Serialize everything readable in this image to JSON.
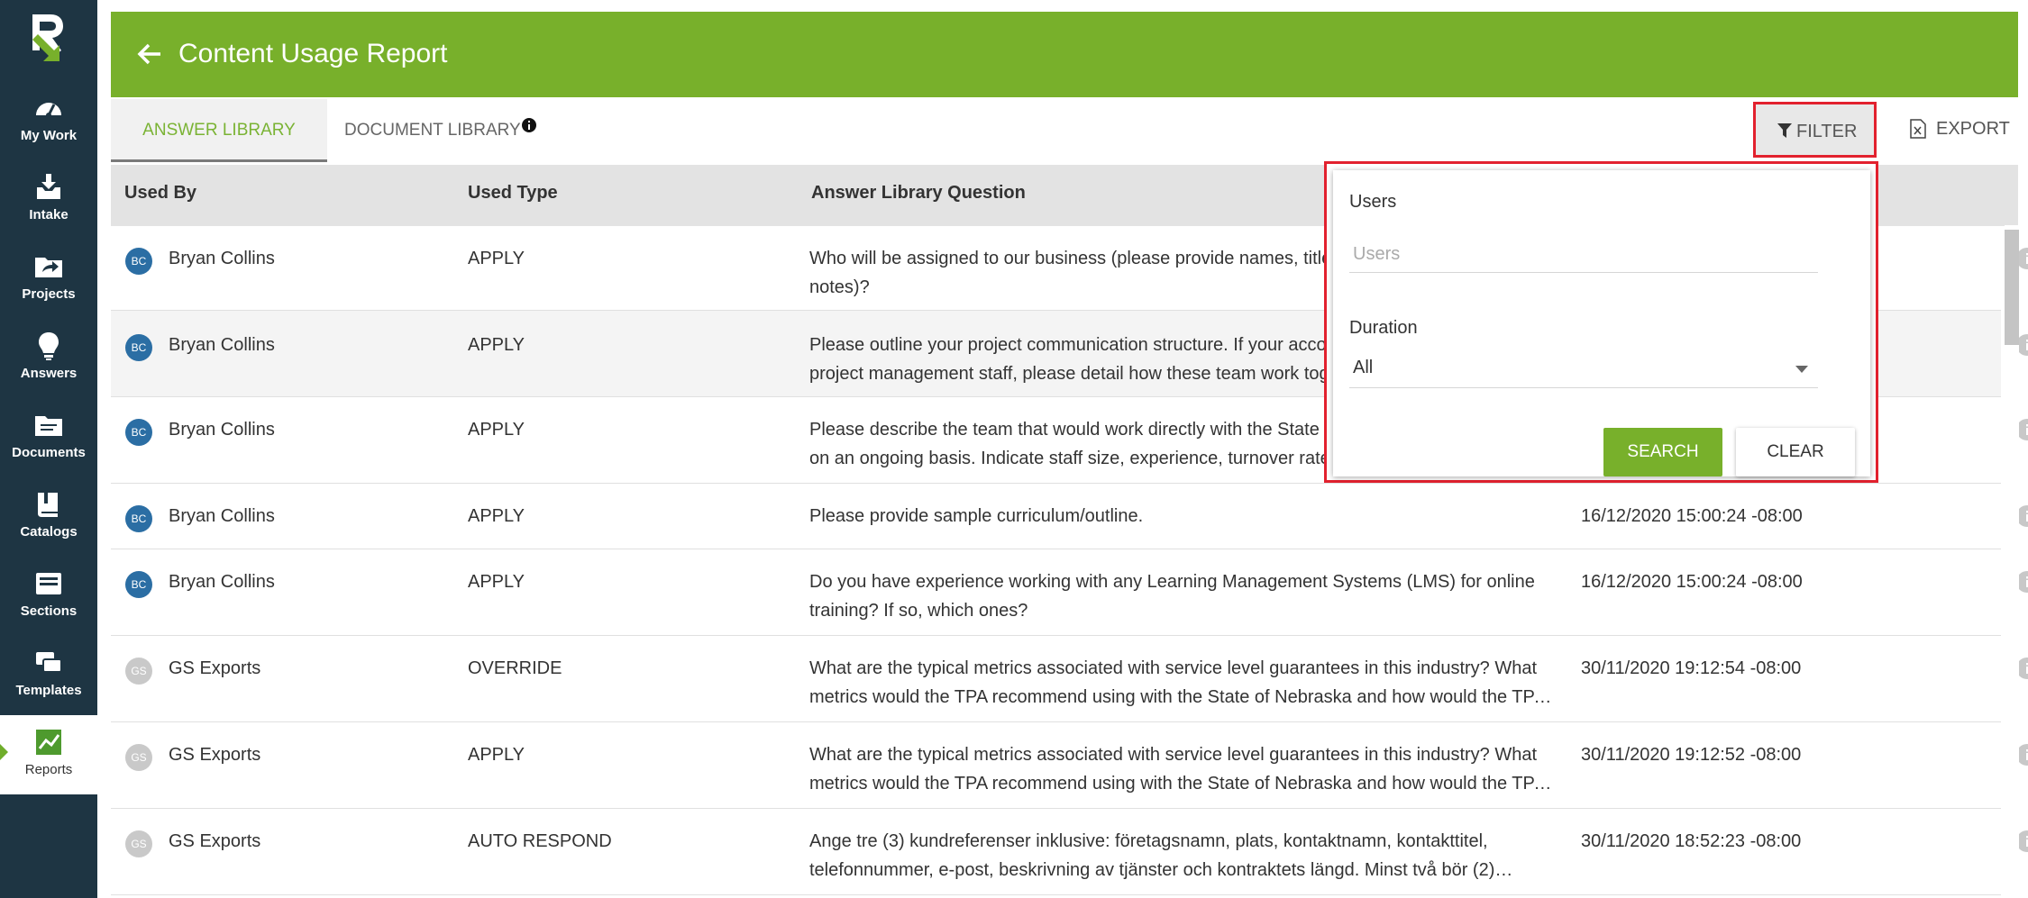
{
  "app": {
    "title": "Content Usage Report"
  },
  "colors": {
    "sidebar": "#1e3543",
    "brand_green": "#78b02b",
    "highlight_red": "#e2212e",
    "avatar_blue": "#2b6ea4",
    "avatar_grey": "#c9c9c9"
  },
  "sidebar": {
    "items": [
      {
        "label": "My Work",
        "icon": "speedometer-icon"
      },
      {
        "label": "Intake",
        "icon": "download-tray-icon"
      },
      {
        "label": "Projects",
        "icon": "folder-share-icon"
      },
      {
        "label": "Answers",
        "icon": "lightbulb-icon"
      },
      {
        "label": "Documents",
        "icon": "folder-docs-icon"
      },
      {
        "label": "Catalogs",
        "icon": "book-icon"
      },
      {
        "label": "Sections",
        "icon": "section-card-icon"
      },
      {
        "label": "Templates",
        "icon": "stacked-cards-icon"
      },
      {
        "label": "Reports",
        "icon": "chart-icon",
        "active": true
      }
    ]
  },
  "tabs": {
    "answer_library": "ANSWER LIBRARY",
    "document_library": "DOCUMENT LIBRARY"
  },
  "toolbar": {
    "filter_label": "FILTER",
    "export_label": "EXPORT"
  },
  "table": {
    "columns": {
      "used_by": "Used By",
      "used_type": "Used Type",
      "question": "Answer Library Question"
    },
    "rows": [
      {
        "initials": "BC",
        "user": "Bryan Collins",
        "type": "APPLY",
        "q1": "Who will be assigned to our business (please provide names, titles",
        "q2": "notes)?",
        "date": ""
      },
      {
        "initials": "BC",
        "user": "Bryan Collins",
        "type": "APPLY",
        "q1": "Please outline your project communication structure. If your acco",
        "q2": "project management staff, please detail how these team work tog",
        "date": ""
      },
      {
        "initials": "BC",
        "user": "Bryan Collins",
        "type": "APPLY",
        "q1": "Please describe the team that would work directly with the State",
        "q2": "on an ongoing basis. Indicate staff size, experience, turnover rates",
        "date": ""
      },
      {
        "initials": "BC",
        "user": "Bryan Collins",
        "type": "APPLY",
        "q1": "Please provide sample curriculum/outline.",
        "q2": "",
        "date": "16/12/2020 15:00:24 -08:00"
      },
      {
        "initials": "BC",
        "user": "Bryan Collins",
        "type": "APPLY",
        "q1": "Do you have experience working with any Learning Management Systems (LMS) for online",
        "q2": "training? If so, which ones?",
        "date": "16/12/2020 15:00:24 -08:00"
      },
      {
        "initials": "GS",
        "user": "GS Exports",
        "type": "OVERRIDE",
        "q1": "What are the typical metrics associated with service level guarantees in this industry? What",
        "q2": "metrics would the TPA recommend using with the State of Nebraska and how would the TPA…",
        "date": "30/11/2020 19:12:54 -08:00"
      },
      {
        "initials": "GS",
        "user": "GS Exports",
        "type": "APPLY",
        "q1": "What are the typical metrics associated with service level guarantees in this industry? What",
        "q2": "metrics would the TPA recommend using with the State of Nebraska and how would the TPA…",
        "date": "30/11/2020 19:12:52 -08:00"
      },
      {
        "initials": "GS",
        "user": "GS Exports",
        "type": "AUTO RESPOND",
        "q1": "Ange tre (3) kundreferenser inklusive: företagsnamn, plats, kontaktnamn, kontakttitel,",
        "q2": "telefonnummer, e-post, beskrivning av tjänster och kontraktets längd. Minst två bör (2)…",
        "date": "30/11/2020 18:52:23 -08:00"
      }
    ]
  },
  "filter": {
    "users_label": "Users",
    "users_placeholder": "Users",
    "duration_label": "Duration",
    "duration_value": "All",
    "search_label": "SEARCH",
    "clear_label": "CLEAR"
  }
}
